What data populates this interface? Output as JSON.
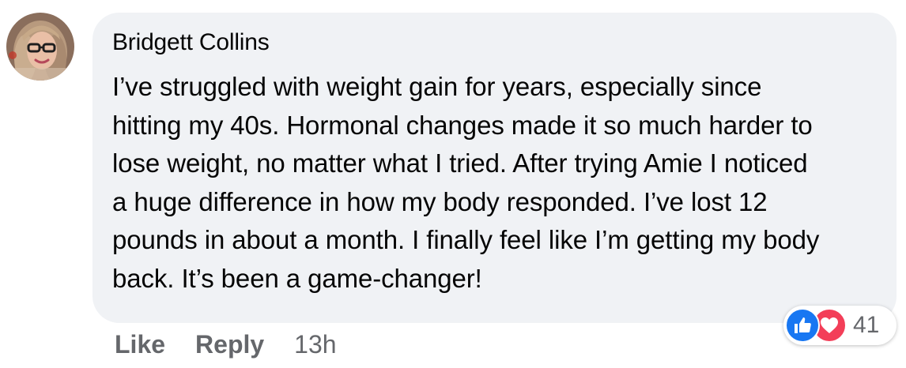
{
  "comment": {
    "author": "Bridgett Collins",
    "text": "I’ve struggled with weight gain for years, especially since\nhitting my 40s. Hormonal changes made it so much harder to\nlose weight, no matter what I tried. After trying Amie I noticed\na huge difference in how my body responded. I’ve lost 12\npounds in about a month. I finally feel like I’m getting my body\nback. It’s been a game-changer!",
    "avatar_icon": "profile-photo"
  },
  "reactions": {
    "icons": [
      "like-icon",
      "love-icon"
    ],
    "count": "41",
    "colors": {
      "like": "#1877f2",
      "love": "#f33e58"
    }
  },
  "actions": {
    "like_label": "Like",
    "reply_label": "Reply",
    "timestamp": "13h"
  },
  "theme": {
    "bubble_bg": "#f0f2f5",
    "text": "#050505",
    "secondary_text": "#65676b"
  }
}
